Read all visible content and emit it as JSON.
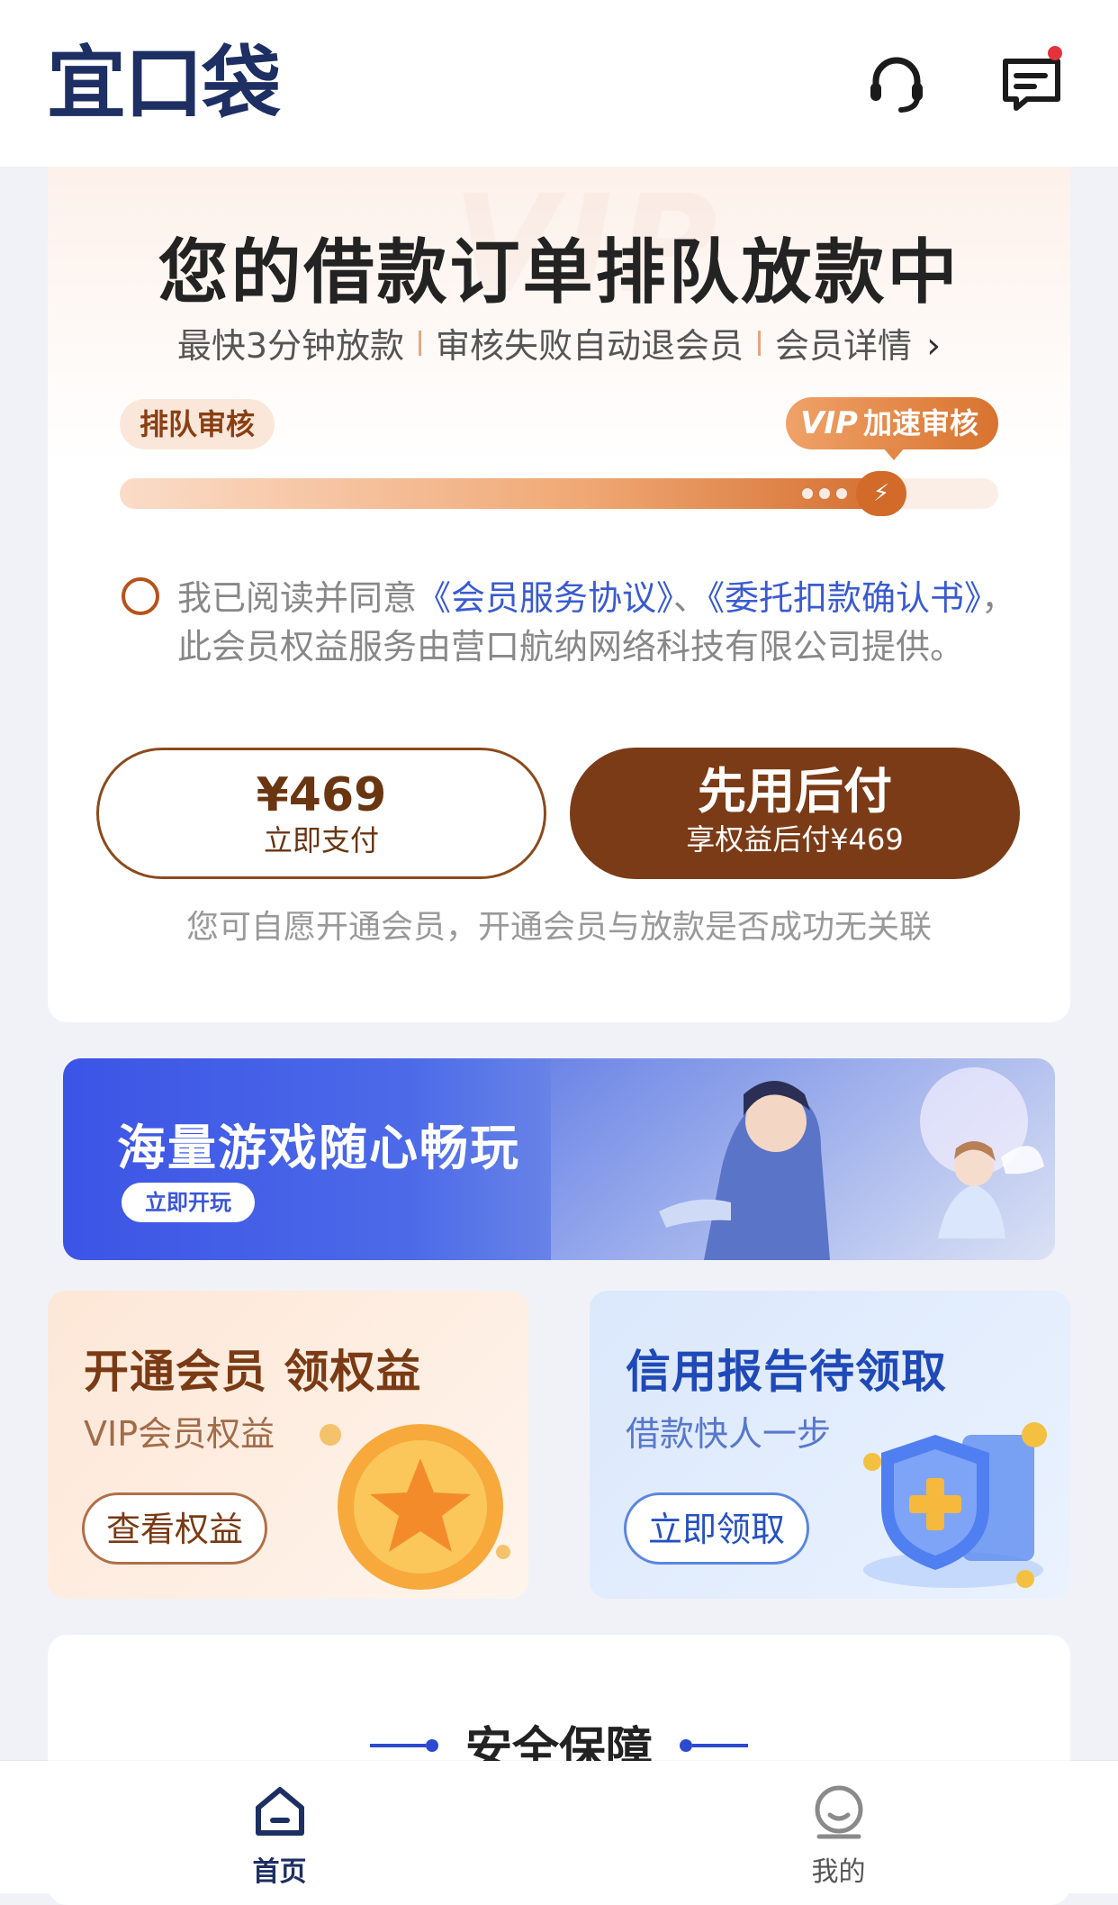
{
  "header": {
    "logo": "宜口袋",
    "service_icon": "headset-icon",
    "message_icon": "message-icon"
  },
  "order": {
    "watermark": "VIP",
    "title": "您的借款订单排队放款中",
    "sub_1": "最快3分钟放款",
    "sub_2": "审核失败自动退会员",
    "sub_3": "会员详情",
    "tag_left": "排队审核",
    "tag_right_vip": "VIP",
    "tag_right_text": "加速审核",
    "progress_fraction": 0.92,
    "agree_prefix": "我已阅读并同意",
    "agree_link1": "《会员服务协议》",
    "agree_sep": "、",
    "agree_link2": "《委托扣款确认书》",
    "agree_suffix": "，此会员权益服务由营口航纳网络科技有限公司提供。",
    "pay_amount": "¥469",
    "pay_label": "立即支付",
    "later_label": "先用后付",
    "later_sub": "享权益后付¥469",
    "notice": "您可自愿开通会员，开通会员与放款是否成功无关联"
  },
  "banner": {
    "title": "海量游戏随心畅玩",
    "button": "立即开玩"
  },
  "promos": {
    "vip": {
      "title": "开通会员 领权益",
      "sub": "VIP会员权益",
      "button": "查看权益"
    },
    "credit": {
      "title": "信用报告待领取",
      "sub": "借款快人一步",
      "button": "立即领取"
    }
  },
  "safety": {
    "title": "安全保障"
  },
  "tabbar": {
    "home": "首页",
    "mine": "我的"
  },
  "colors": {
    "brand": "#1d2f63",
    "accent_brown": "#7b3b17",
    "link_blue": "#3a5bd0"
  }
}
